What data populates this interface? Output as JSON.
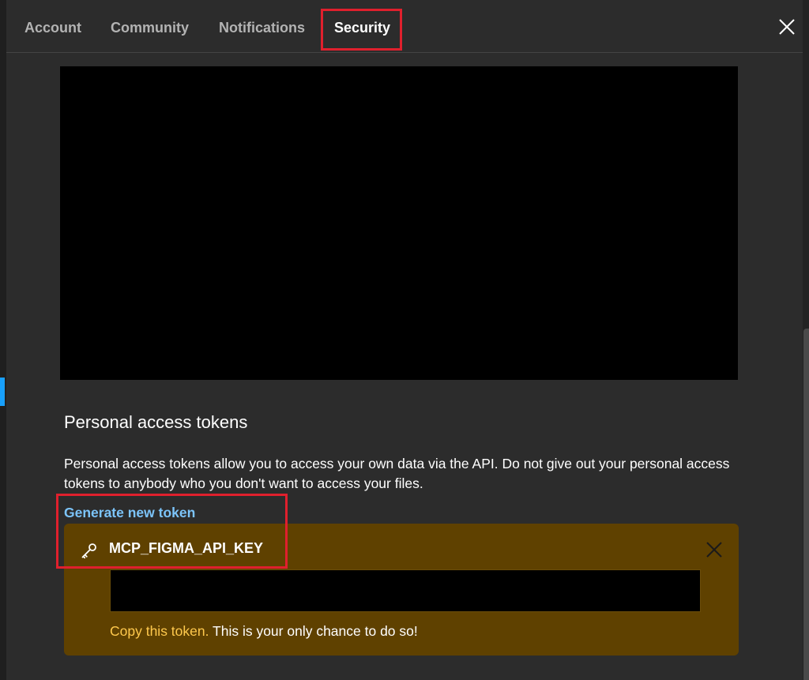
{
  "tabs": [
    {
      "label": "Account",
      "active": false
    },
    {
      "label": "Community",
      "active": false
    },
    {
      "label": "Notifications",
      "active": false
    },
    {
      "label": "Security",
      "active": true
    }
  ],
  "pat": {
    "title": "Personal access tokens",
    "description": "Personal access tokens allow you to access your own data via the API. Do not give out your personal access tokens to anybody who you don't want to access your files.",
    "generate_label": "Generate new token"
  },
  "token": {
    "name": "MCP_FIGMA_API_KEY",
    "value": "",
    "copy_note_highlight": "Copy this token.",
    "copy_note_rest": " This is your only chance to do so!"
  },
  "colors": {
    "background": "#2c2c2c",
    "highlight_box": "#e0202d",
    "link": "#7cc4fa",
    "token_box": "#5f4100",
    "copy_note": "#ffc94d"
  },
  "icons": {
    "close": "close-icon",
    "key": "key-icon",
    "token_close": "close-icon"
  }
}
